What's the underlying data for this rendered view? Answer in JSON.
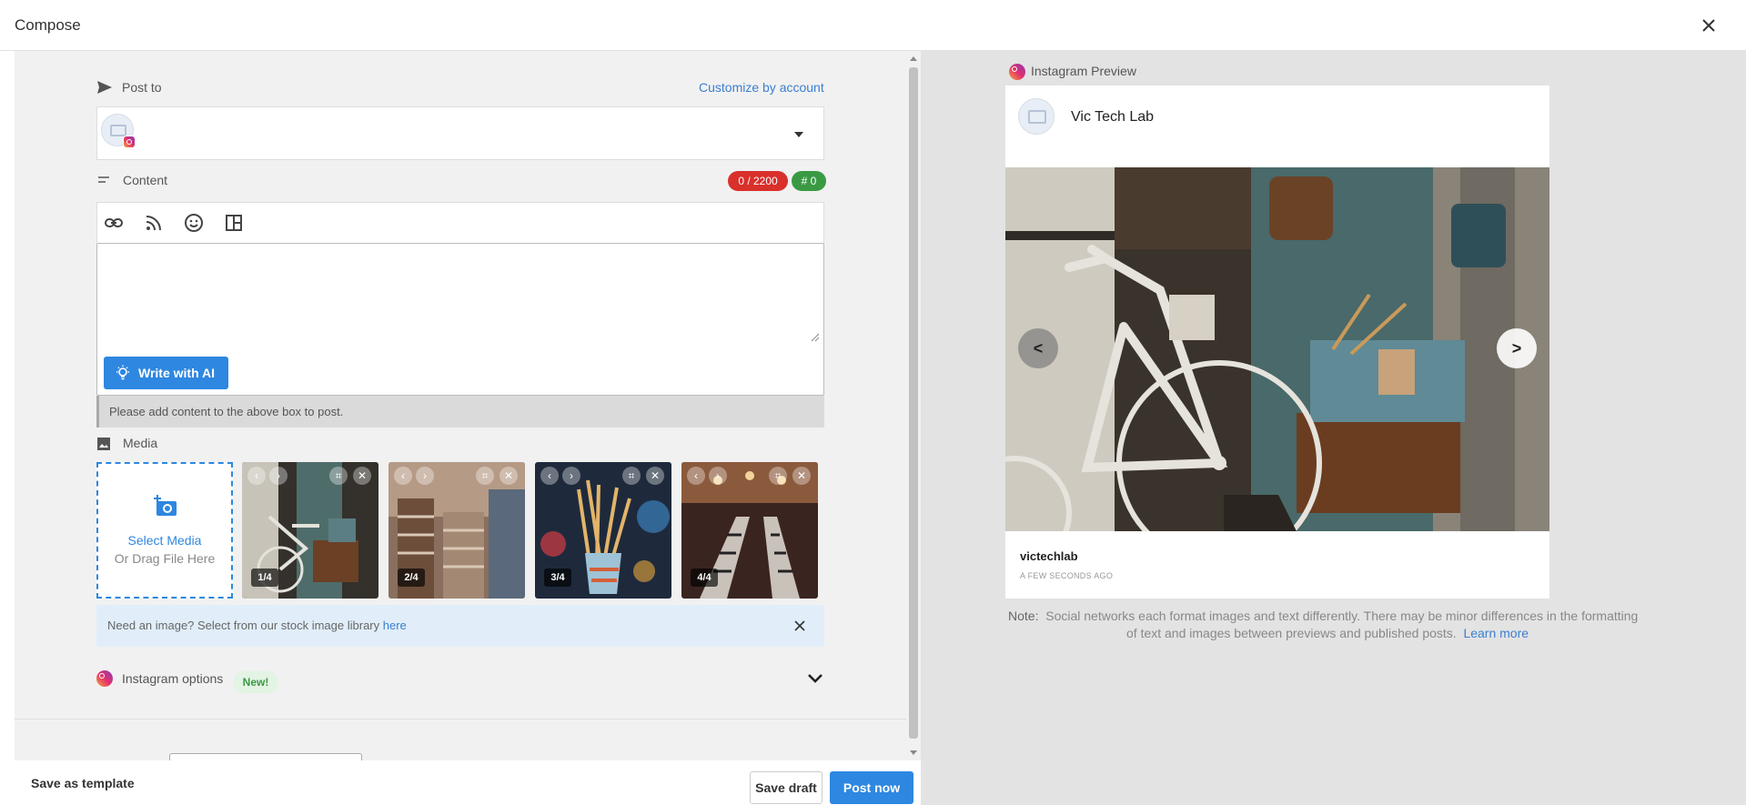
{
  "window": {
    "title": "Compose"
  },
  "post_to": {
    "label": "Post to",
    "customize_link": "Customize by account"
  },
  "content": {
    "label": "Content",
    "char_count": "0 / 2200",
    "hashtag_count": "# 0",
    "char_color": "#d9302c",
    "hashtag_color": "#3a9a44",
    "tools": [
      "link-icon",
      "rss-icon",
      "emoji-icon",
      "template-icon"
    ],
    "write_ai_label": "Write with AI",
    "warning": "Please add content to the above box to post."
  },
  "media": {
    "label": "Media",
    "select_label": "Select Media",
    "drag_label": "Or Drag File Here",
    "thumbnails": [
      {
        "badge": "1/4"
      },
      {
        "badge": "2/4"
      },
      {
        "badge": "3/4"
      },
      {
        "badge": "4/4"
      }
    ],
    "stock_text": "Need an image? Select from our stock image library",
    "stock_link": "here"
  },
  "instagram_options": {
    "label": "Instagram options",
    "new_badge": "New!"
  },
  "footer": {
    "save_template": "Save as template",
    "save_draft": "Save draft",
    "post_now": "Post now"
  },
  "preview": {
    "header": "Instagram Preview",
    "profile_name": "Vic Tech Lab",
    "prev_label": "<",
    "next_label": ">",
    "username": "victechlab",
    "timestamp": "A FEW SECONDS AGO",
    "note_label": "Note:",
    "note_line1": "Social networks each format images and text differently. There may be minor differences in the formatting",
    "note_line2": "of text and images between previews and published posts.",
    "learn_more": "Learn more"
  },
  "colors": {
    "accent": "#2e87e0",
    "link": "#3b7fd1"
  }
}
